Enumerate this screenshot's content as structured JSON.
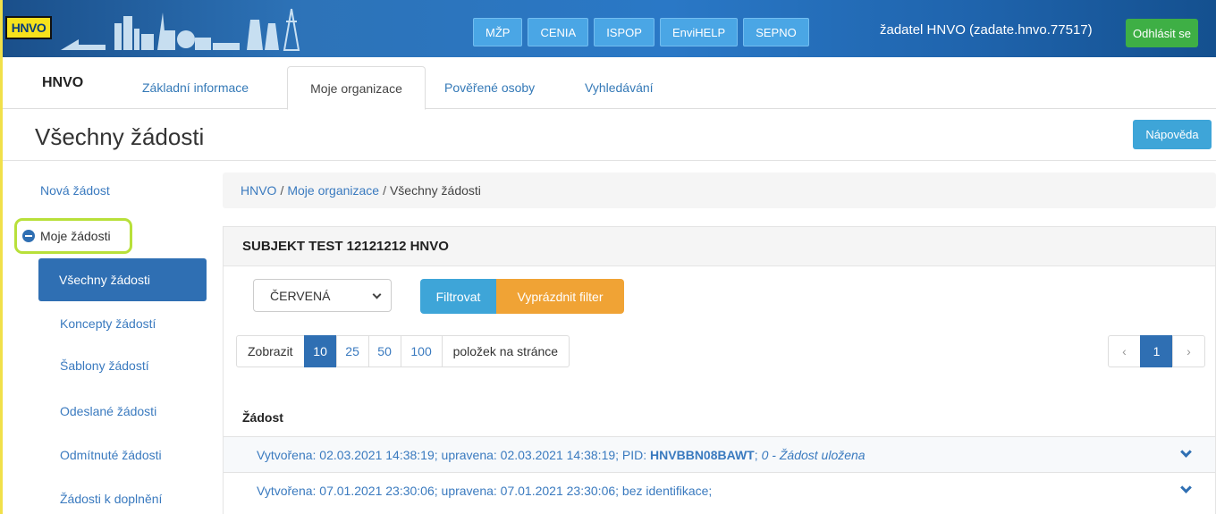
{
  "banner": {
    "logo_text": "HNVO",
    "nav": [
      "MŽP",
      "CENIA",
      "ISPOP",
      "EnviHELP",
      "SEPNO"
    ],
    "user": "žadatel HNVO (zadate.hnvo.77517)",
    "logout": "Odhlásit se"
  },
  "tabs": {
    "brand": "HNVO",
    "items": [
      "Základní informace",
      "Moje organizace",
      "Pověřené osoby",
      "Vyhledávání"
    ],
    "active": "Moje organizace"
  },
  "page": {
    "title": "Všechny žádosti",
    "help": "Nápověda"
  },
  "sidebar": {
    "new_request": "Nová žádost",
    "group": "Moje žádosti",
    "items": [
      "Všechny žádosti",
      "Koncepty žádostí",
      "Šablony žádostí",
      "Odeslané žádosti",
      "Odmítnuté žádosti",
      "Žádosti k doplnění"
    ]
  },
  "breadcrumb": {
    "items": [
      "HNVO",
      "Moje organizace",
      "Všechny žádosti"
    ],
    "separator": "/"
  },
  "panel": {
    "title": "SUBJEKT TEST 12121212 HNVO",
    "filter_value": "ČERVENÁ",
    "filter_button": "Filtrovat",
    "clear_button": "Vyprázdnit filter",
    "show_label": "Zobrazit",
    "page_sizes": [
      "10",
      "25",
      "50",
      "100"
    ],
    "per_page_label": "položek na stránce",
    "pager": {
      "prev": "‹",
      "current": "1",
      "next": "›"
    },
    "column": "Žádost",
    "rows": [
      {
        "text": "Vytvořena: 02.03.2021 14:38:19; upravena: 02.03.2021 14:38:19; PID:",
        "pid": "HNVBBN08BAWT",
        "suffix": ";",
        "state": "0 - Žádost uložena"
      },
      {
        "text": "Vytvořena: 07.01.2021 23:30:06; upravena: 07.01.2021 23:30:06; bez identifikace;",
        "pid": "",
        "suffix": "",
        "state": ""
      }
    ]
  },
  "colors": {
    "accent_blue": "#2f6fb3",
    "info_blue": "#3ea5d8",
    "warning_orange": "#f0a335",
    "success_green": "#3eaf45",
    "highlight_lime": "#b8e03a"
  }
}
